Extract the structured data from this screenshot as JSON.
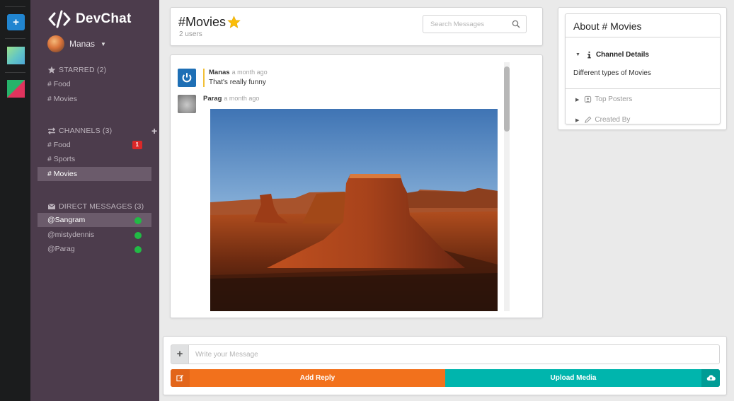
{
  "app": {
    "brand": "DevChat"
  },
  "colors": {
    "sidebar": "#4c3c4c",
    "rail": "#1b1c1d",
    "accent_blue": "#2185d0",
    "reply_orange": "#f2711c",
    "upload_teal": "#00b5ad",
    "badge_red": "#db2828",
    "online_green": "#21ba45"
  },
  "rail": {
    "add_icon": "plus-icon"
  },
  "user": {
    "name": "Manas"
  },
  "sidebar": {
    "starred": {
      "title": "STARRED (2)",
      "items": [
        "# Food",
        "# Movies"
      ]
    },
    "channels": {
      "title": "CHANNELS (3)",
      "items": [
        {
          "label": "# Food",
          "badge": "1"
        },
        {
          "label": "# Sports"
        },
        {
          "label": "# Movies",
          "active": true
        }
      ]
    },
    "direct": {
      "title": "DIRECT MESSAGES (3)",
      "items": [
        {
          "label": "@Sangram",
          "online": true
        },
        {
          "label": "@mistydennis",
          "online": true
        },
        {
          "label": "@Parag",
          "online": true
        }
      ]
    }
  },
  "header": {
    "channel": "#Movies",
    "users": "2 users",
    "search_placeholder": "Search Messages"
  },
  "messages": [
    {
      "author": "Manas",
      "time": "a month ago",
      "text": "That's really funny"
    },
    {
      "author": "Parag",
      "time": "a month ago"
    }
  ],
  "about": {
    "title": "About # Movies",
    "details_label": "Channel Details",
    "description": "Different types of Movies",
    "top_posters": "Top Posters",
    "created_by": "Created By"
  },
  "composer": {
    "placeholder": "Write your Message",
    "reply_label": "Add Reply",
    "upload_label": "Upload Media"
  }
}
